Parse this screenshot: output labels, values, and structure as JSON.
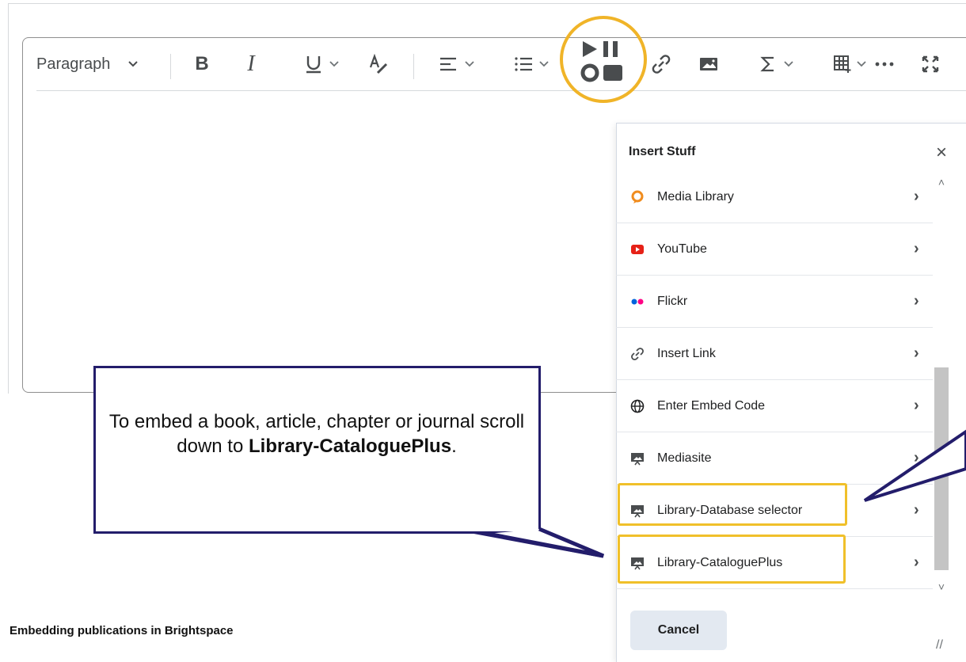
{
  "toolbar": {
    "paragraph_label": "Paragraph",
    "bold_label": "B",
    "italic_label": "I"
  },
  "dialog": {
    "title": "Insert Stuff",
    "items": [
      {
        "label": "Media Library",
        "icon": "media-library-icon"
      },
      {
        "label": "YouTube",
        "icon": "youtube-icon"
      },
      {
        "label": "Flickr",
        "icon": "flickr-icon"
      },
      {
        "label": "Insert Link",
        "icon": "link-icon"
      },
      {
        "label": "Enter Embed Code",
        "icon": "globe-icon"
      },
      {
        "label": "Mediasite",
        "icon": "presentation-icon"
      },
      {
        "label": "Library-Database selector",
        "icon": "presentation-icon"
      },
      {
        "label": "Library-CataloguePlus",
        "icon": "presentation-icon"
      }
    ],
    "cancel_label": "Cancel"
  },
  "callout": {
    "text_before": "To embed a book, article, chapter or journal scroll down to ",
    "text_bold": "Library-CataloguePlus",
    "text_after": "."
  },
  "footer": {
    "caption": "Embedding publications in Brightspace"
  },
  "colors": {
    "highlight": "#f0b428",
    "callout_border": "#231d6b",
    "youtube_red": "#e62117",
    "flickr_blue": "#0063dc",
    "flickr_pink": "#ff0084",
    "media_orange": "#f08c1e"
  }
}
